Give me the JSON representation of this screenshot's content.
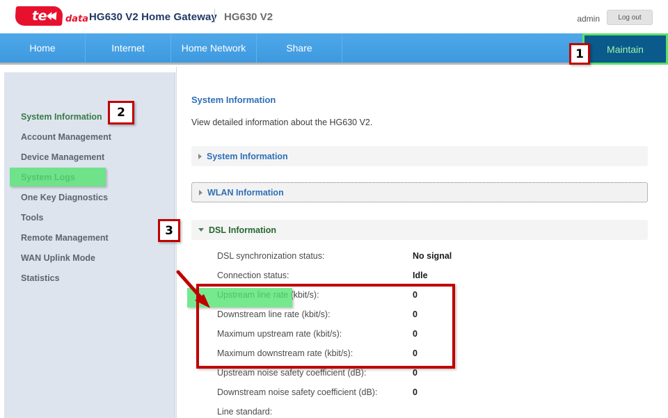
{
  "header": {
    "logo_text": "te",
    "logo_suffix": "data",
    "logo_icon": "tedata-logo",
    "product_title": "HG630 V2 Home Gateway",
    "model": "HG630 V2",
    "user": "admin",
    "logout_label": "Log out"
  },
  "nav": {
    "tabs": [
      {
        "label": "Home"
      },
      {
        "label": "Internet"
      },
      {
        "label": "Home Network"
      },
      {
        "label": "Share"
      }
    ],
    "active_tab": {
      "label": "Maintain"
    }
  },
  "sidebar": {
    "items": [
      {
        "label": "System Information"
      },
      {
        "label": "Account Management"
      },
      {
        "label": "Device Management"
      },
      {
        "label": "System Logs"
      },
      {
        "label": "One Key Diagnostics"
      },
      {
        "label": "Tools"
      },
      {
        "label": "Remote Management"
      },
      {
        "label": "WAN Uplink Mode"
      },
      {
        "label": "Statistics"
      }
    ]
  },
  "content": {
    "title": "System Information",
    "description": "View detailed information about the HG630 V2.",
    "panels": [
      {
        "title": "System Information",
        "state": "collapsed"
      },
      {
        "title": "WLAN Information",
        "state": "collapsed"
      },
      {
        "title": "DSL Information",
        "state": "expanded"
      }
    ],
    "dsl_rows": [
      {
        "label": "DSL synchronization status:",
        "value": "No signal"
      },
      {
        "label": "Connection status:",
        "value": "Idle"
      },
      {
        "label": "Upstream line rate (kbit/s):",
        "value": "0"
      },
      {
        "label": "Downstream line rate (kbit/s):",
        "value": "0"
      },
      {
        "label": "Maximum upstream rate (kbit/s):",
        "value": "0"
      },
      {
        "label": "Maximum downstream rate (kbit/s):",
        "value": "0"
      },
      {
        "label": "Upstream noise safety coefficient (dB):",
        "value": "0"
      },
      {
        "label": "Downstream noise safety coefficient (dB):",
        "value": "0"
      },
      {
        "label": "Line standard:",
        "value": ""
      }
    ]
  },
  "annotations": {
    "badges": [
      {
        "number": "1"
      },
      {
        "number": "2"
      },
      {
        "number": "3"
      }
    ],
    "accent_color": "#c00000",
    "highlight_color": "#50e26e"
  }
}
